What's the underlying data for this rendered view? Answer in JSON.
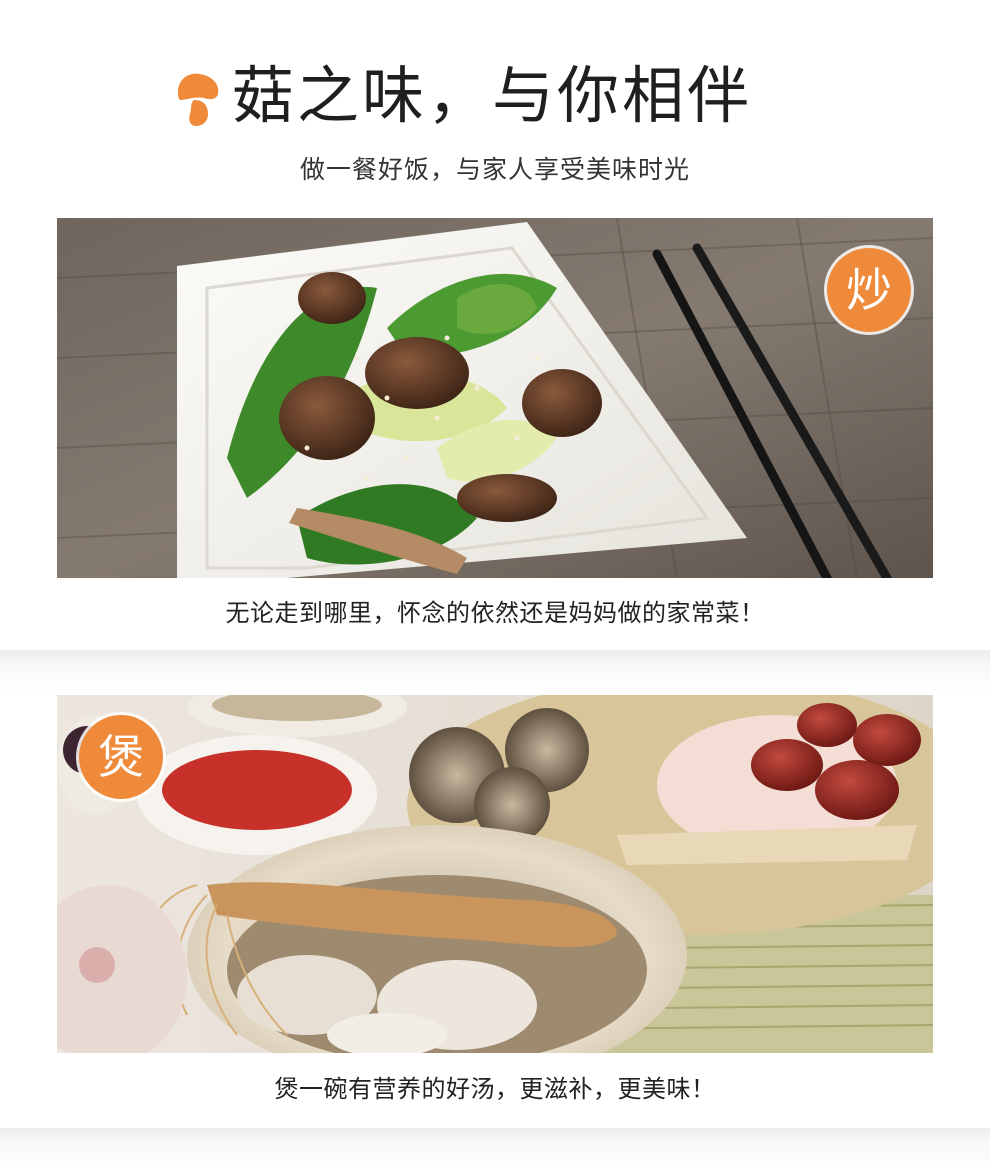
{
  "header": {
    "title": "菇之味，与你相伴",
    "subtitle": "做一餐好饭，与家人享受美味时光",
    "icon": "mushroom-icon"
  },
  "sections": [
    {
      "badge": "炒",
      "caption": "无论走到哪里，怀念的依然还是妈妈做的家常菜！",
      "image": "stir-fried-mushroom-bok-choy-photo"
    },
    {
      "badge": "煲",
      "caption": "煲一碗有营养的好汤，更滋补，更美味！",
      "image": "ginseng-chicken-mushroom-soup-photo"
    }
  ],
  "colors": {
    "accent": "#ef8a3a",
    "text": "#222222",
    "divider": "#ececec"
  }
}
